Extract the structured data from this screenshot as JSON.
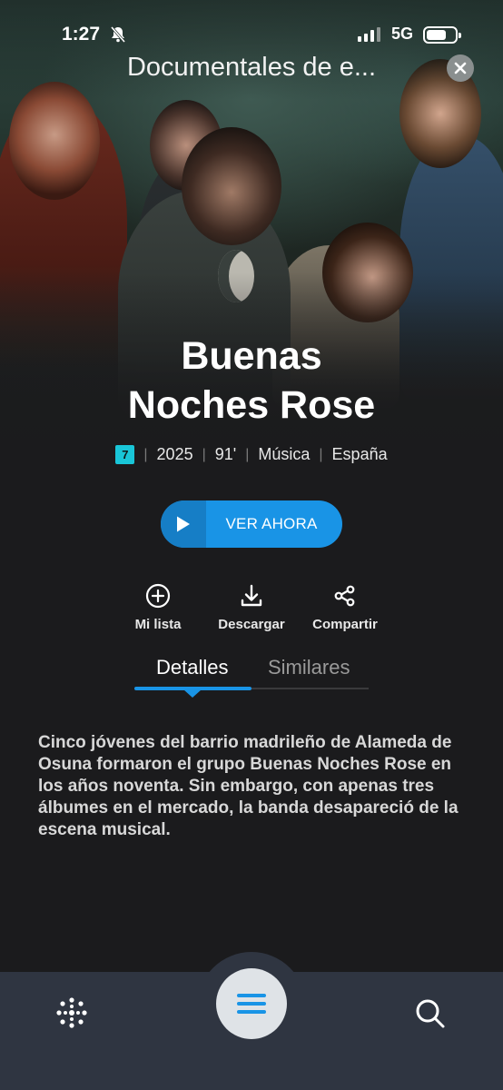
{
  "status_bar": {
    "time": "1:27",
    "network": "5G",
    "battery_level": 0.7,
    "icons": [
      "silent-bell-icon",
      "signal-icon",
      "battery-icon"
    ]
  },
  "header": {
    "title": "Documentales de e...",
    "close_icon": "close-icon"
  },
  "movie": {
    "title_line1": "Buenas",
    "title_line2": "Noches Rose",
    "age_rating": "7",
    "year": "2025",
    "duration": "91'",
    "genre": "Música",
    "country": "España"
  },
  "watch_button": {
    "label": "VER AHORA",
    "icon": "play-icon"
  },
  "actions": [
    {
      "label": "Mi lista",
      "icon": "add-circle-icon"
    },
    {
      "label": "Descargar",
      "icon": "download-icon"
    },
    {
      "label": "Compartir",
      "icon": "share-icon"
    }
  ],
  "tabs": [
    {
      "label": "Detalles",
      "active": true
    },
    {
      "label": "Similares",
      "active": false
    }
  ],
  "description": "Cinco jóvenes del barrio madrileño de Alameda de Osuna formaron el grupo Buenas Noches Rose en los años noventa. Sin embargo, con apenas tres álbumes en el mercado, la banda desapareció de la escena musical.",
  "bottom_nav": {
    "home_icon": "dots-logo-icon",
    "menu_icon": "menu-icon",
    "search_icon": "search-icon"
  },
  "colors": {
    "accent": "#1994e6",
    "age_badge": "#19c6d8",
    "background": "#1b1b1d",
    "nav_bg": "#2f3541"
  }
}
